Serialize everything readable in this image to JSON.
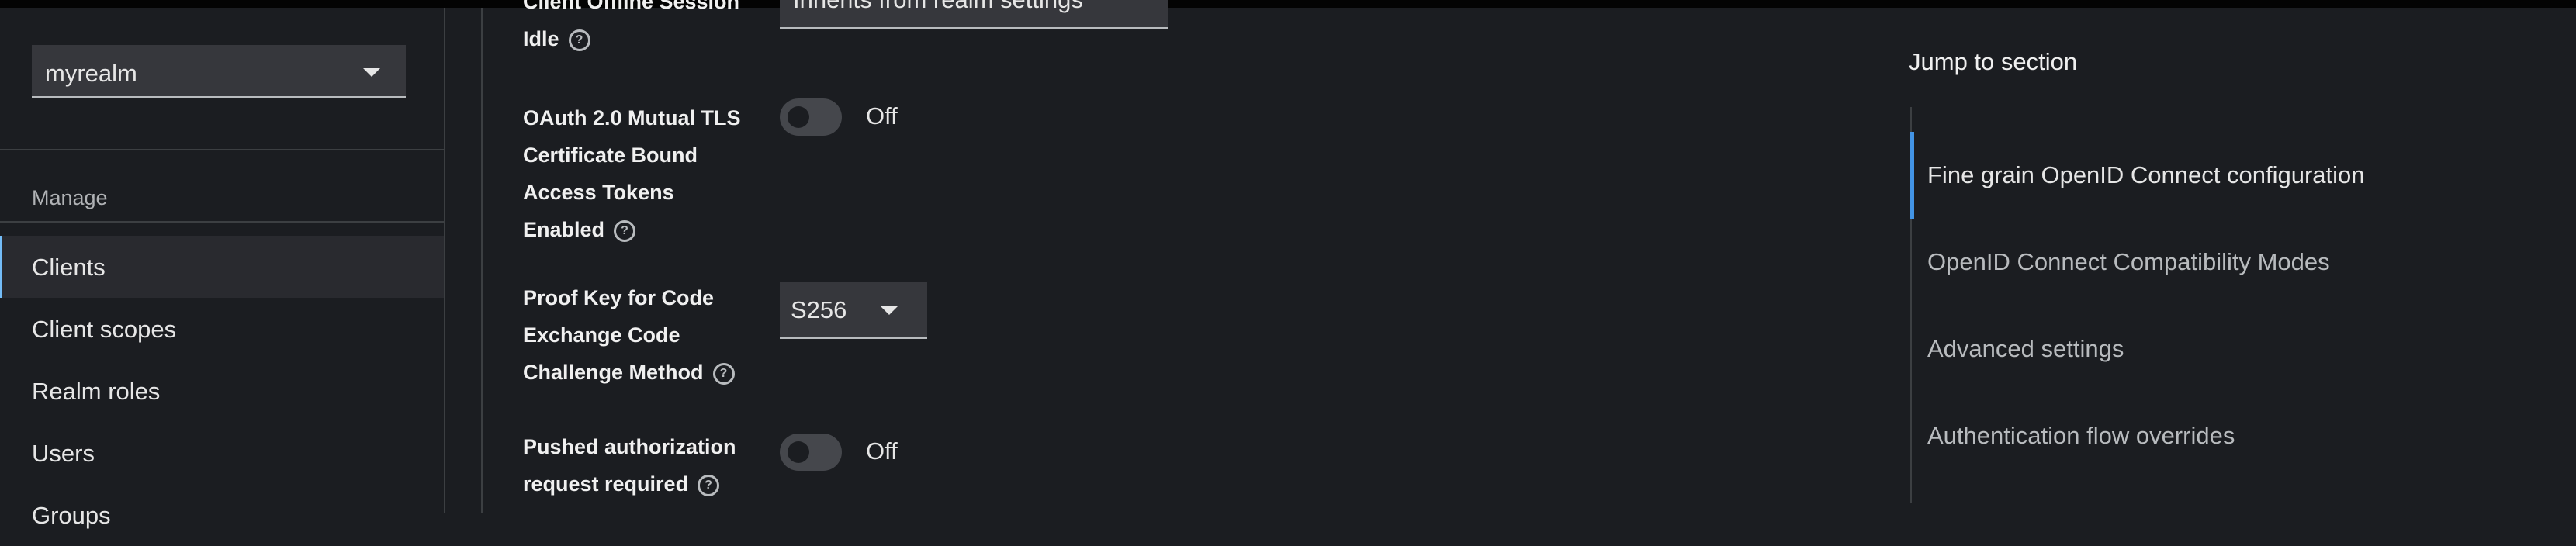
{
  "sidebar": {
    "realm_selector": {
      "value": "myrealm"
    },
    "section_title": "Manage",
    "items": [
      {
        "label": "Clients",
        "active": true
      },
      {
        "label": "Client scopes",
        "active": false
      },
      {
        "label": "Realm roles",
        "active": false
      },
      {
        "label": "Users",
        "active": false
      },
      {
        "label": "Groups",
        "active": false
      }
    ]
  },
  "form": {
    "offline_idle": {
      "label_line1": "Client Offline Session",
      "label_line2": "Idle",
      "value": "Inherits from realm settings"
    },
    "mtls": {
      "label_lines": [
        "OAuth 2.0 Mutual TLS",
        "Certificate Bound",
        "Access Tokens",
        "Enabled"
      ],
      "state": "Off"
    },
    "pkce": {
      "label_lines": [
        "Proof Key for Code",
        "Exchange Code",
        "Challenge Method"
      ],
      "value": "S256"
    },
    "par": {
      "label_lines": [
        "Pushed authorization",
        "request required"
      ],
      "state": "Off"
    },
    "help_glyph": "?"
  },
  "jump_to_section": {
    "title": "Jump to section",
    "items": [
      {
        "label": "Fine grain OpenID Connect configuration",
        "active": true
      },
      {
        "label": "OpenID Connect Compatibility Modes",
        "active": false
      },
      {
        "label": "Advanced settings",
        "active": false
      },
      {
        "label": "Authentication flow overrides",
        "active": false
      }
    ]
  },
  "colors": {
    "accent_active_nav": "#73bcf7",
    "accent_jump_active": "#4394e5",
    "background": "#1b1d21"
  }
}
